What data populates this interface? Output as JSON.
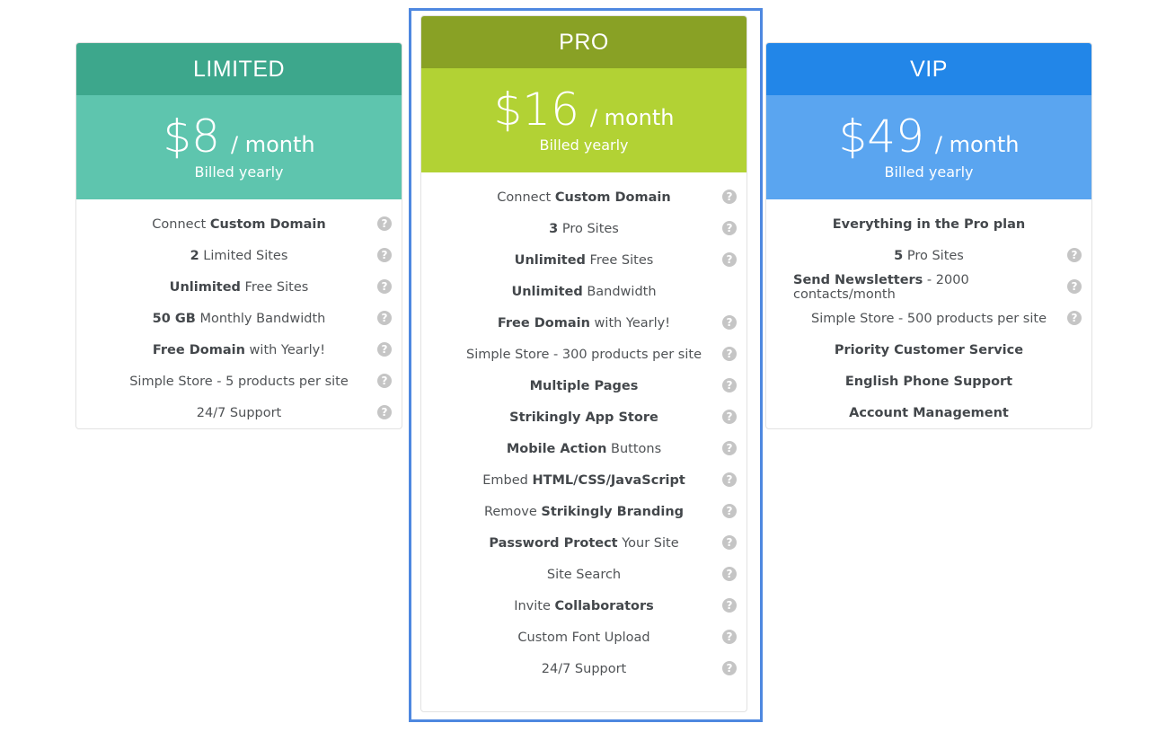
{
  "colors": {
    "limited_header": "#3da78c",
    "limited_price": "#5ec5ae",
    "pro_header": "#89a125",
    "pro_price": "#b2d234",
    "vip_header": "#2286e8",
    "vip_price": "#5aa5f0",
    "highlight_border": "#4e88e0",
    "help_icon": "#c5c5c5"
  },
  "plans": [
    {
      "name": "LIMITED",
      "price": "$8",
      "period": "/ month",
      "billing": "Billed yearly",
      "features": [
        {
          "parts": [
            {
              "t": "Connect ",
              "b": false
            },
            {
              "t": "Custom Domain",
              "b": true
            }
          ],
          "help": true,
          "icon": "help-circle-icon"
        },
        {
          "parts": [
            {
              "t": "2",
              "b": true
            },
            {
              "t": " Limited Sites",
              "b": false
            }
          ],
          "help": true,
          "icon": "help-circle-icon"
        },
        {
          "parts": [
            {
              "t": "Unlimited",
              "b": true
            },
            {
              "t": " Free Sites",
              "b": false
            }
          ],
          "help": true,
          "icon": "help-circle-icon"
        },
        {
          "parts": [
            {
              "t": "50 GB",
              "b": true
            },
            {
              "t": " Monthly Bandwidth",
              "b": false
            }
          ],
          "help": true,
          "icon": "help-circle-icon"
        },
        {
          "parts": [
            {
              "t": "Free Domain",
              "b": true
            },
            {
              "t": " with Yearly!",
              "b": false
            }
          ],
          "help": true,
          "icon": "help-circle-icon"
        },
        {
          "parts": [
            {
              "t": "Simple Store - 5 products per site",
              "b": false
            }
          ],
          "help": true,
          "icon": "help-circle-icon"
        },
        {
          "parts": [
            {
              "t": "24/7 Support",
              "b": false
            }
          ],
          "help": true,
          "icon": "help-circle-icon"
        }
      ]
    },
    {
      "name": "PRO",
      "price": "$16",
      "period": "/ month",
      "billing": "Billed yearly",
      "highlighted": true,
      "features": [
        {
          "parts": [
            {
              "t": "Connect ",
              "b": false
            },
            {
              "t": "Custom Domain",
              "b": true
            }
          ],
          "help": true,
          "icon": "help-circle-icon"
        },
        {
          "parts": [
            {
              "t": "3",
              "b": true
            },
            {
              "t": " Pro Sites",
              "b": false
            }
          ],
          "help": true,
          "icon": "help-circle-icon"
        },
        {
          "parts": [
            {
              "t": "Unlimited",
              "b": true
            },
            {
              "t": " Free Sites",
              "b": false
            }
          ],
          "help": true,
          "icon": "help-circle-icon"
        },
        {
          "parts": [
            {
              "t": "Unlimited",
              "b": true
            },
            {
              "t": " Bandwidth",
              "b": false
            }
          ],
          "help": false
        },
        {
          "parts": [
            {
              "t": "Free Domain",
              "b": true
            },
            {
              "t": " with Yearly!",
              "b": false
            }
          ],
          "help": true,
          "icon": "help-circle-icon"
        },
        {
          "parts": [
            {
              "t": "Simple Store - 300 products per site",
              "b": false
            }
          ],
          "help": true,
          "icon": "help-circle-icon"
        },
        {
          "parts": [
            {
              "t": "Multiple Pages",
              "b": true
            }
          ],
          "help": true,
          "icon": "help-circle-icon"
        },
        {
          "parts": [
            {
              "t": "Strikingly App Store",
              "b": true
            }
          ],
          "help": true,
          "icon": "help-circle-icon"
        },
        {
          "parts": [
            {
              "t": "Mobile Action",
              "b": true
            },
            {
              "t": " Buttons",
              "b": false
            }
          ],
          "help": true,
          "icon": "help-circle-icon"
        },
        {
          "parts": [
            {
              "t": "Embed ",
              "b": false
            },
            {
              "t": "HTML/CSS/JavaScript",
              "b": true
            }
          ],
          "help": true,
          "icon": "help-circle-icon"
        },
        {
          "parts": [
            {
              "t": "Remove ",
              "b": false
            },
            {
              "t": "Strikingly Branding",
              "b": true
            }
          ],
          "help": true,
          "icon": "help-circle-icon"
        },
        {
          "parts": [
            {
              "t": "Password Protect",
              "b": true
            },
            {
              "t": " Your Site",
              "b": false
            }
          ],
          "help": true,
          "icon": "help-circle-icon"
        },
        {
          "parts": [
            {
              "t": "Site Search",
              "b": false
            }
          ],
          "help": true,
          "icon": "help-circle-icon"
        },
        {
          "parts": [
            {
              "t": "Invite ",
              "b": false
            },
            {
              "t": "Collaborators",
              "b": true
            }
          ],
          "help": true,
          "icon": "help-circle-icon"
        },
        {
          "parts": [
            {
              "t": "Custom Font Upload",
              "b": false
            }
          ],
          "help": true,
          "icon": "help-circle-icon"
        },
        {
          "parts": [
            {
              "t": "24/7 Support",
              "b": false
            }
          ],
          "help": true,
          "icon": "help-circle-icon"
        }
      ]
    },
    {
      "name": "VIP",
      "price": "$49",
      "period": "/ month",
      "billing": "Billed yearly",
      "features": [
        {
          "parts": [
            {
              "t": "Everything in the Pro plan",
              "b": true
            }
          ],
          "help": false
        },
        {
          "parts": [
            {
              "t": "5",
              "b": true
            },
            {
              "t": " Pro Sites",
              "b": false
            }
          ],
          "help": true,
          "icon": "help-circle-icon"
        },
        {
          "parts": [
            {
              "t": "Send Newsletters",
              "b": true
            },
            {
              "t": " - 2000 contacts/month",
              "b": false
            }
          ],
          "help": true,
          "icon": "help-circle-icon"
        },
        {
          "parts": [
            {
              "t": "Simple Store - 500 products per site",
              "b": false
            }
          ],
          "help": true,
          "icon": "help-circle-icon"
        },
        {
          "parts": [
            {
              "t": "Priority Customer Service",
              "b": true
            }
          ],
          "help": false
        },
        {
          "parts": [
            {
              "t": "English Phone Support",
              "b": true
            }
          ],
          "help": false
        },
        {
          "parts": [
            {
              "t": "Account Management",
              "b": true
            }
          ],
          "help": false
        }
      ]
    }
  ],
  "help_glyph": "?"
}
